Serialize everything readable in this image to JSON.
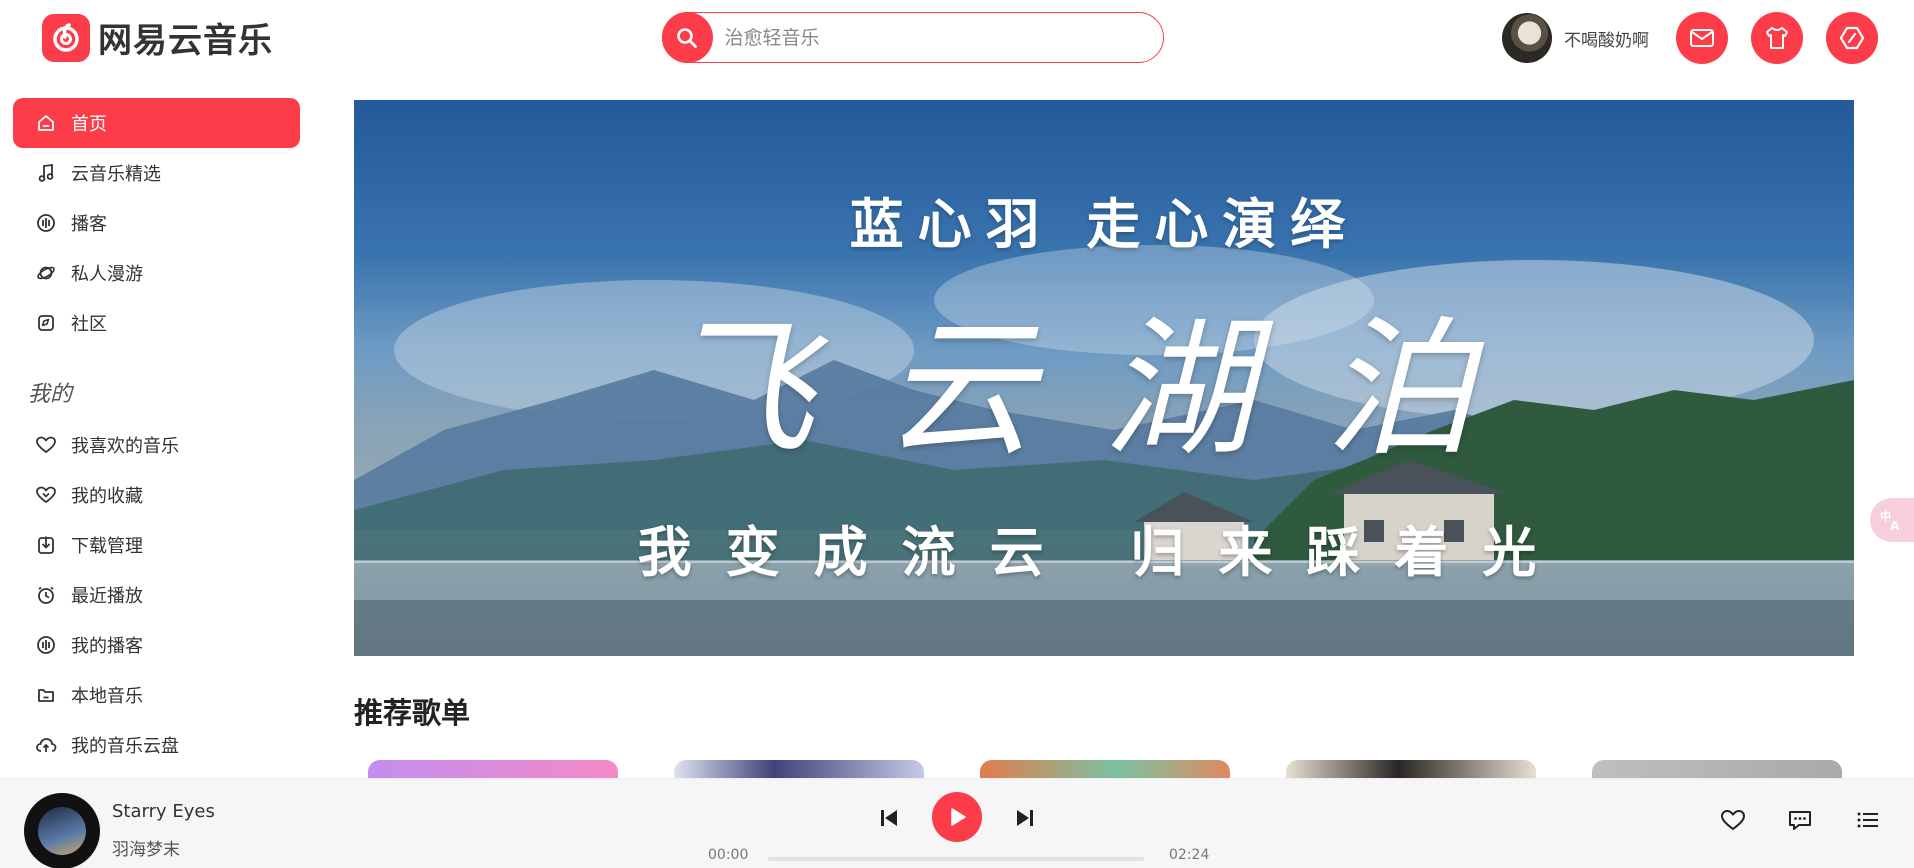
{
  "app": {
    "logo_text": "网易云音乐",
    "brand_color": "#fc3d49"
  },
  "search": {
    "placeholder": "治愈轻音乐",
    "value": ""
  },
  "user": {
    "name": "不喝酸奶啊"
  },
  "header_buttons": [
    {
      "icon": "mail-icon"
    },
    {
      "icon": "skin-icon"
    },
    {
      "icon": "settings-icon"
    }
  ],
  "sidebar": {
    "main_items": [
      {
        "label": "首页",
        "icon": "home-icon",
        "active": true
      },
      {
        "label": "云音乐精选",
        "icon": "music-note-icon",
        "active": false
      },
      {
        "label": "播客",
        "icon": "podcast-icon",
        "active": false
      },
      {
        "label": "私人漫游",
        "icon": "planet-icon",
        "active": false
      },
      {
        "label": "社区",
        "icon": "community-icon",
        "active": false
      }
    ],
    "my_section_title": "我的",
    "my_items": [
      {
        "label": "我喜欢的音乐",
        "icon": "heart-icon"
      },
      {
        "label": "我的收藏",
        "icon": "heart-circle-icon"
      },
      {
        "label": "下载管理",
        "icon": "download-icon"
      },
      {
        "label": "最近播放",
        "icon": "clock-icon"
      },
      {
        "label": "我的播客",
        "icon": "podcast-icon"
      },
      {
        "label": "本地音乐",
        "icon": "folder-icon"
      },
      {
        "label": "我的音乐云盘",
        "icon": "cloud-icon"
      }
    ]
  },
  "banner": {
    "line1": "蓝心羽 走心演绎",
    "line2": "飞云湖泊",
    "line3": "我变成流云 归来踩着光"
  },
  "recommend": {
    "title": "推荐歌单"
  },
  "player": {
    "song": "Starry Eyes",
    "artist": "羽海梦末",
    "current_time": "00:00",
    "total_time": "02:24",
    "progress": 0
  }
}
